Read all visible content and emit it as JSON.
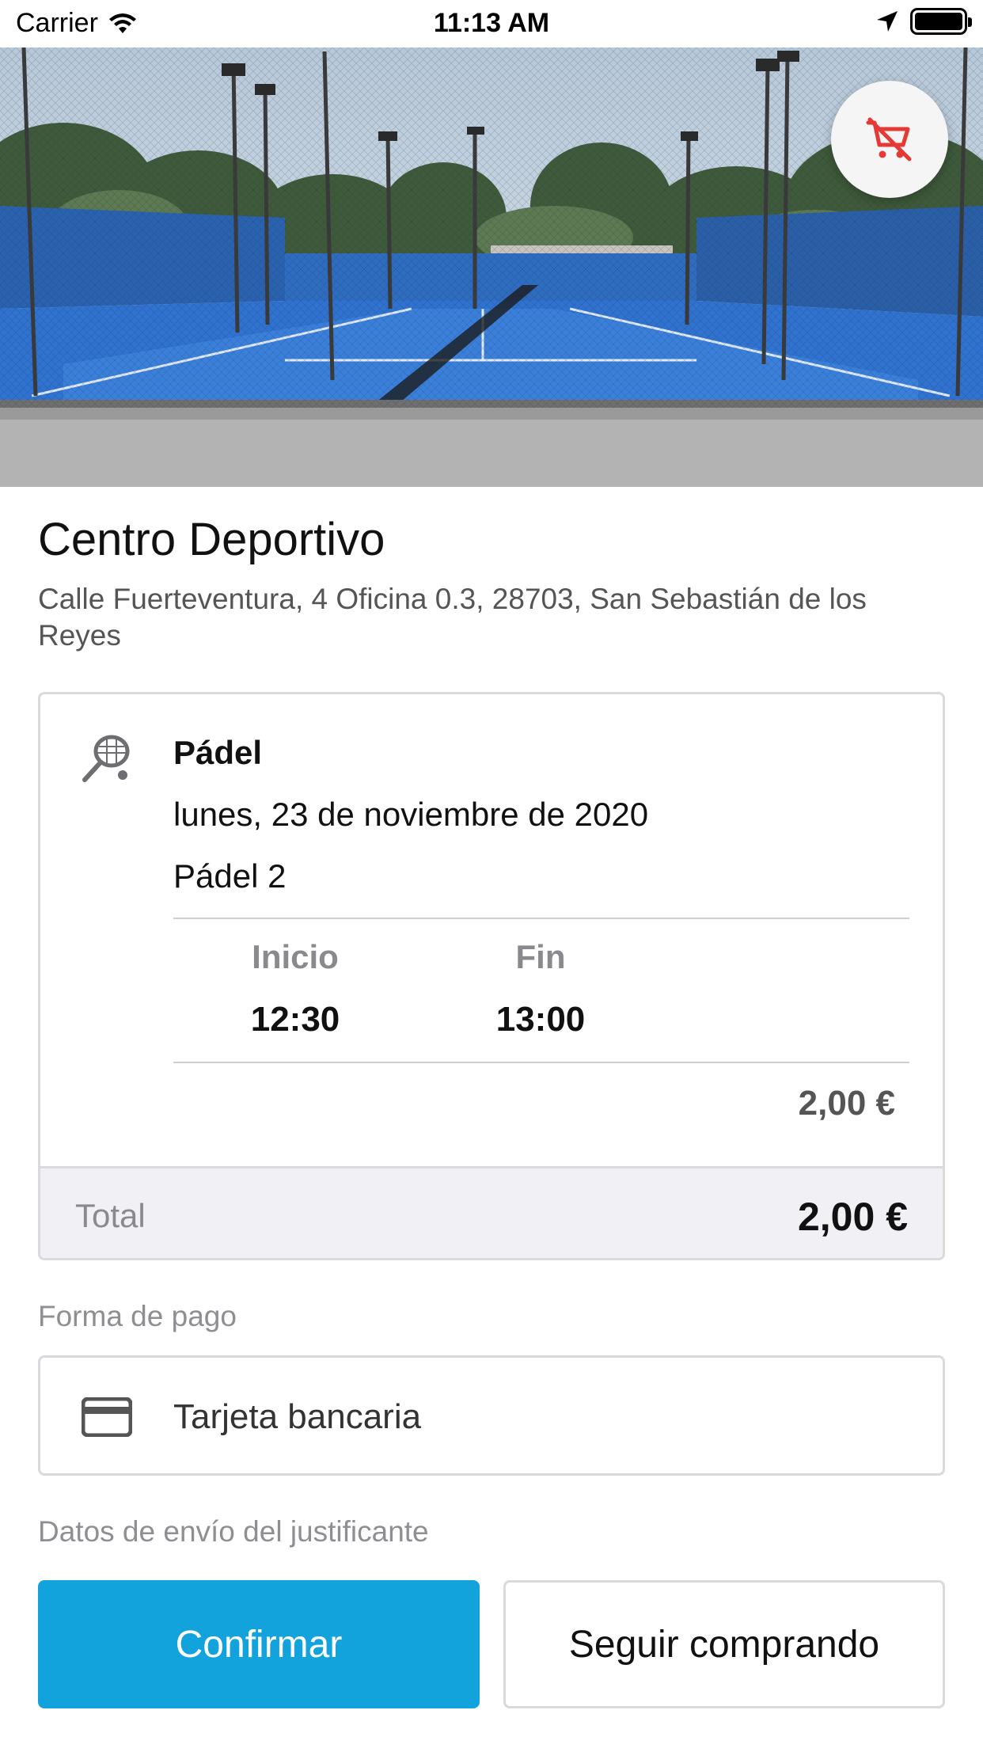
{
  "status_bar": {
    "carrier": "Carrier",
    "time": "11:13 AM"
  },
  "header": {
    "cart_button_icon": "remove-shopping-cart-icon",
    "cart_icon_color": "#e53935"
  },
  "venue": {
    "name": "Centro Deportivo",
    "address": "Calle Fuerteventura, 4 Oficina 0.3, 28703, San Sebastián de los Reyes"
  },
  "booking": {
    "sport_icon": "padel-racket-icon",
    "sport": "Pádel",
    "date": "lunes, 23 de noviembre de 2020",
    "court": "Pádel 2",
    "start_label": "Inicio",
    "start_time": "12:30",
    "end_label": "Fin",
    "end_time": "13:00",
    "price": "2,00 €",
    "total_label": "Total",
    "total_value": "2,00 €"
  },
  "payment": {
    "section_label": "Forma de pago",
    "method_icon": "credit-card-icon",
    "method": "Tarjeta bancaria"
  },
  "receipt": {
    "section_label": "Datos de envío del justificante"
  },
  "actions": {
    "confirm_label": "Confirmar",
    "continue_label": "Seguir comprando"
  },
  "colors": {
    "accent": "#12a3dd",
    "total_bar": "#f0f0f5"
  }
}
